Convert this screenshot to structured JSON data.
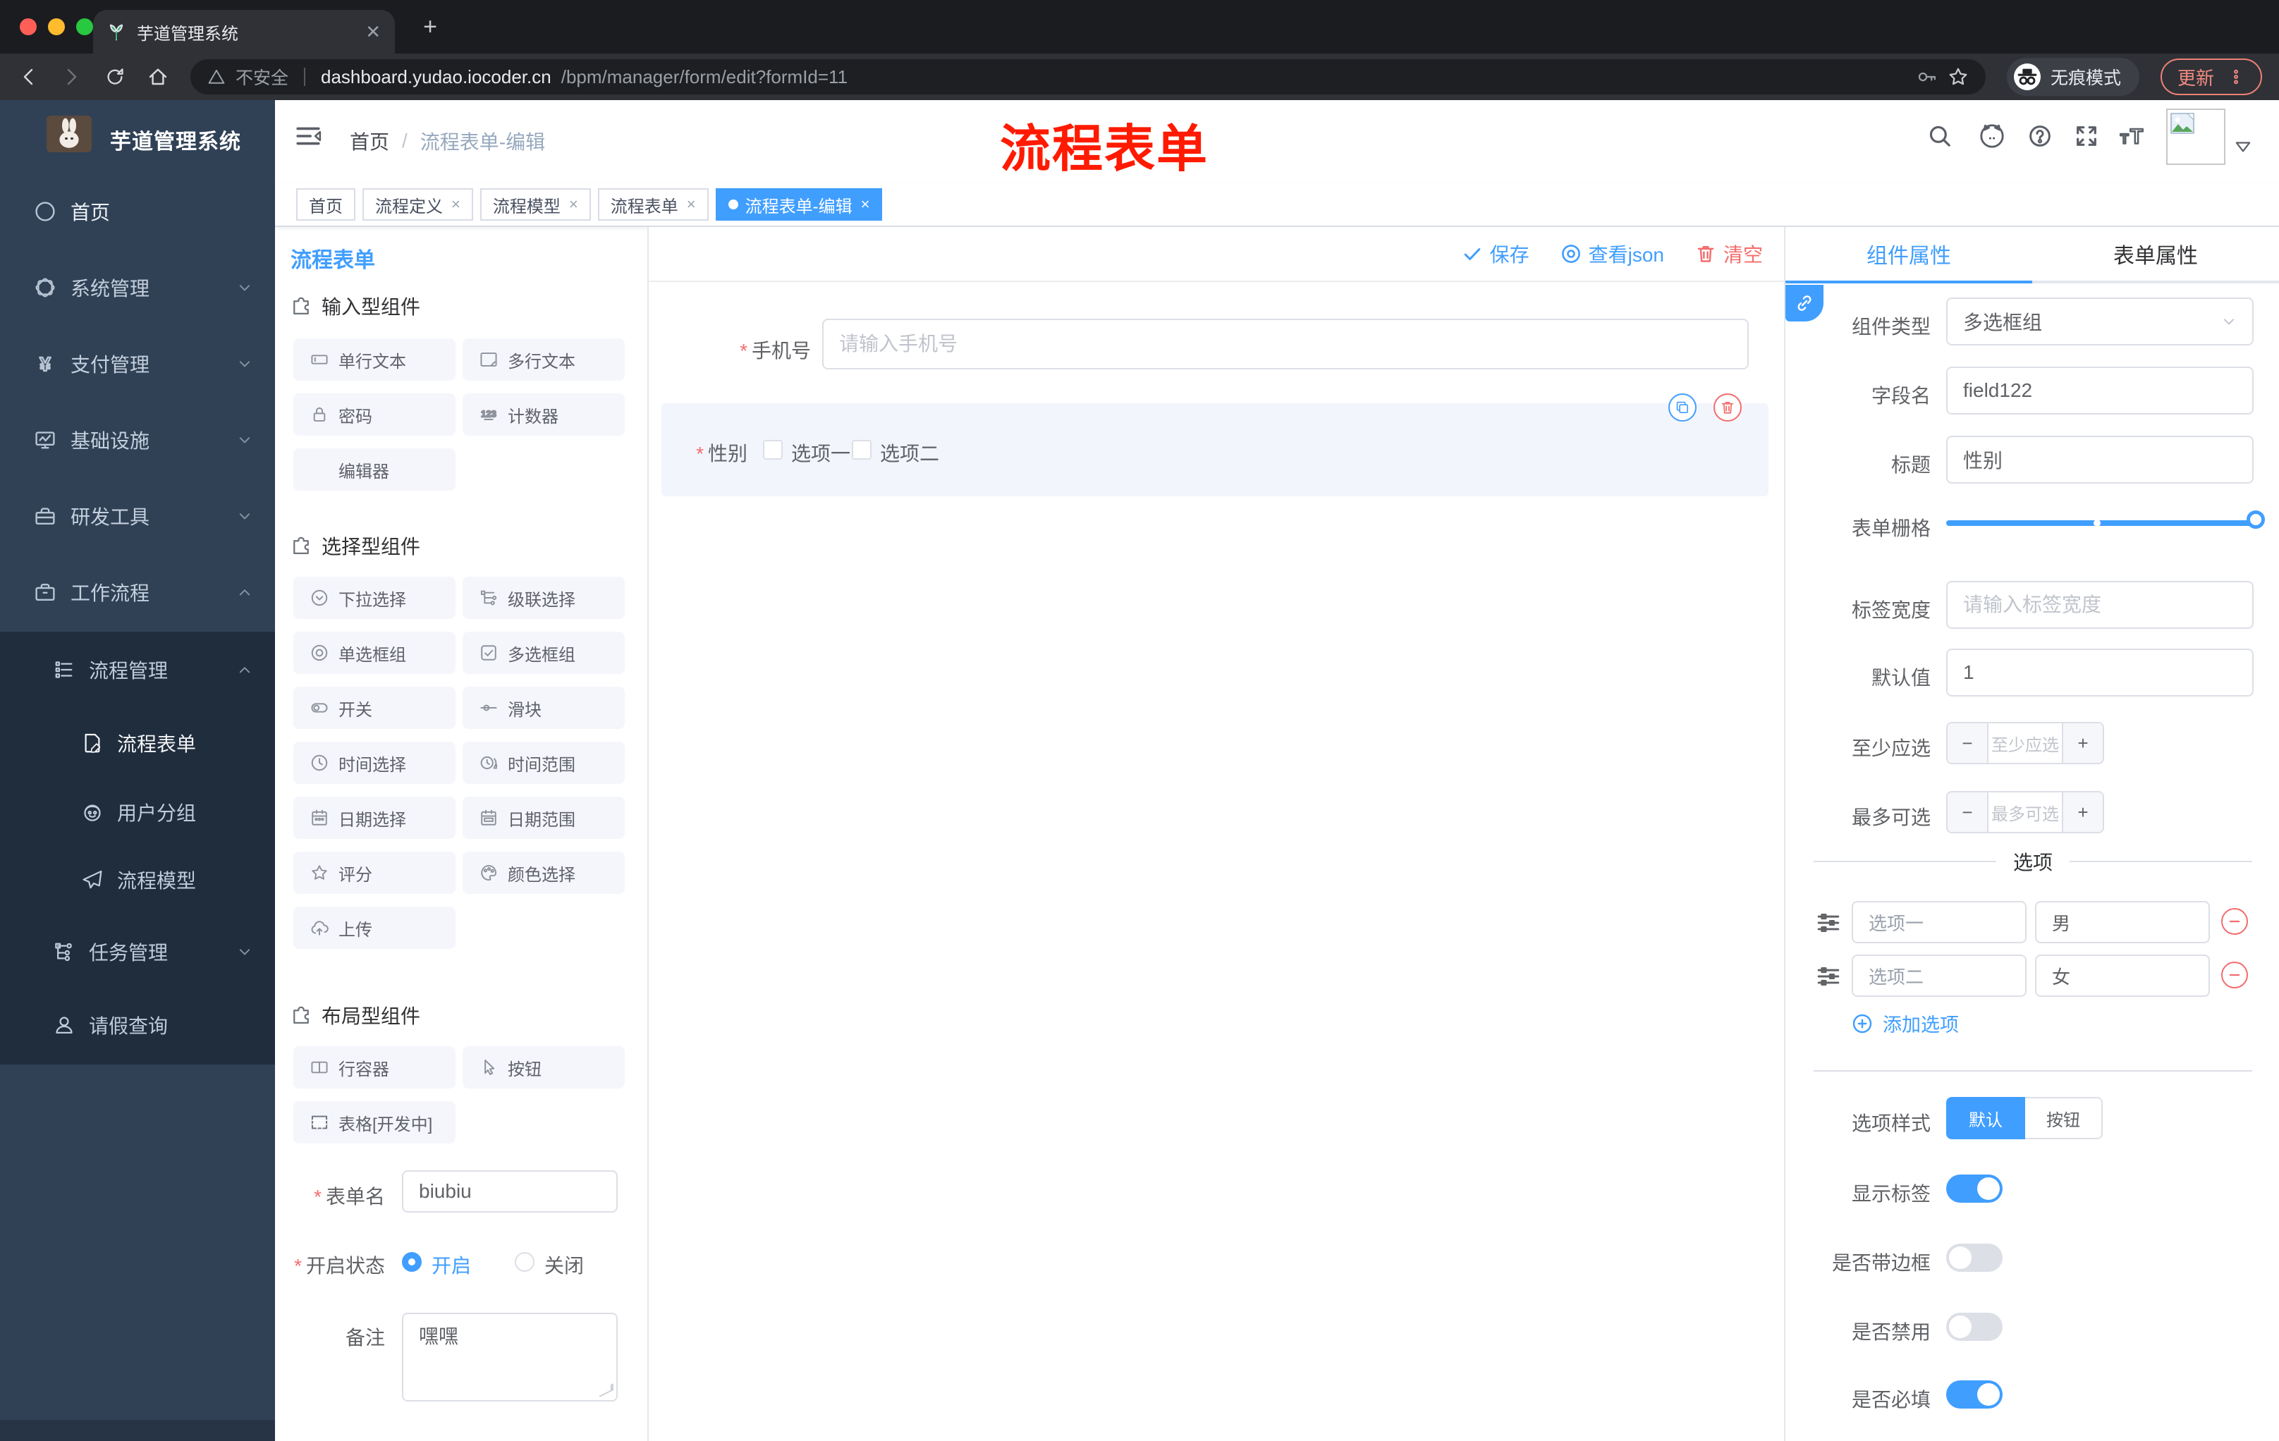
{
  "browser": {
    "tab_title": "芋道管理系统",
    "insecure_label": "不安全",
    "url_domain": "dashboard.yudao.iocoder.cn",
    "url_path": "/bpm/manager/form/edit?formId=11",
    "incognito_label": "无痕模式",
    "update_label": "更新"
  },
  "sidebar": {
    "logo_title": "芋道管理系统",
    "menu": [
      {
        "label": "首页"
      },
      {
        "label": "系统管理"
      },
      {
        "label": "支付管理"
      },
      {
        "label": "基础设施"
      },
      {
        "label": "研发工具"
      },
      {
        "label": "工作流程"
      }
    ],
    "sub": [
      {
        "label": "流程管理"
      },
      {
        "label": "流程表单"
      },
      {
        "label": "用户分组"
      },
      {
        "label": "流程模型"
      },
      {
        "label": "任务管理"
      },
      {
        "label": "请假查询"
      }
    ]
  },
  "header": {
    "breadcrumb_home": "首页",
    "breadcrumb_sep": "/",
    "breadcrumb_current": "流程表单-编辑",
    "watermark": "流程表单"
  },
  "tags": [
    {
      "label": "首页"
    },
    {
      "label": "流程定义"
    },
    {
      "label": "流程模型"
    },
    {
      "label": "流程表单"
    },
    {
      "label": "流程表单-编辑"
    }
  ],
  "designer": {
    "panel_title": "流程表单",
    "actions": {
      "save": "保存",
      "view_json": "查看json",
      "clear": "清空"
    },
    "palette": {
      "sections": [
        {
          "title": "输入型组件",
          "items": [
            {
              "label": "单行文本"
            },
            {
              "label": "多行文本"
            },
            {
              "label": "密码"
            },
            {
              "label": "计数器"
            },
            {
              "label": "编辑器"
            }
          ]
        },
        {
          "title": "选择型组件",
          "items": [
            {
              "label": "下拉选择"
            },
            {
              "label": "级联选择"
            },
            {
              "label": "单选框组"
            },
            {
              "label": "多选框组"
            },
            {
              "label": "开关"
            },
            {
              "label": "滑块"
            },
            {
              "label": "时间选择"
            },
            {
              "label": "时间范围"
            },
            {
              "label": "日期选择"
            },
            {
              "label": "日期范围"
            },
            {
              "label": "评分"
            },
            {
              "label": "颜色选择"
            },
            {
              "label": "上传"
            }
          ]
        },
        {
          "title": "布局型组件",
          "items": [
            {
              "label": "行容器"
            },
            {
              "label": "按钮"
            },
            {
              "label": "表格[开发中]"
            }
          ]
        }
      ]
    },
    "meta": {
      "name_label": "表单名",
      "name_value": "biubiu",
      "status_label": "开启状态",
      "status_on": "开启",
      "status_off": "关闭",
      "remark_label": "备注",
      "remark_value": "嘿嘿"
    },
    "canvas": {
      "phone_label": "手机号",
      "phone_placeholder": "请输入手机号",
      "gender_label": "性别",
      "gender_option1": "选项一",
      "gender_option2": "选项二"
    },
    "props": {
      "tab_component": "组件属性",
      "tab_form": "表单属性",
      "type_label": "组件类型",
      "type_value": "多选框组",
      "field_label": "字段名",
      "field_value": "field122",
      "title_label": "标题",
      "title_value": "性别",
      "grid_label": "表单栅格",
      "label_width_label": "标签宽度",
      "label_width_placeholder": "请输入标签宽度",
      "default_label": "默认值",
      "default_value": "1",
      "min_label": "至少应选",
      "min_placeholder": "至少应选",
      "max_label": "最多可选",
      "max_placeholder": "最多可选",
      "options_title": "选项",
      "options": [
        {
          "label": "选项一",
          "value": "男"
        },
        {
          "label": "选项二",
          "value": "女"
        }
      ],
      "add_option": "添加选项",
      "style_label": "选项样式",
      "style_default": "默认",
      "style_button": "按钮",
      "show_label_label": "显示标签",
      "border_label": "是否带边框",
      "disabled_label": "是否禁用",
      "required_label": "是否必填"
    }
  },
  "colors": {
    "accent": "#409eff",
    "danger": "#f56c6c",
    "sidebar_bg": "#304156",
    "submenu_bg": "#1f2d3d",
    "traffic_red": "#ff5f57",
    "traffic_yellow": "#febc2e",
    "traffic_green": "#28c840"
  }
}
